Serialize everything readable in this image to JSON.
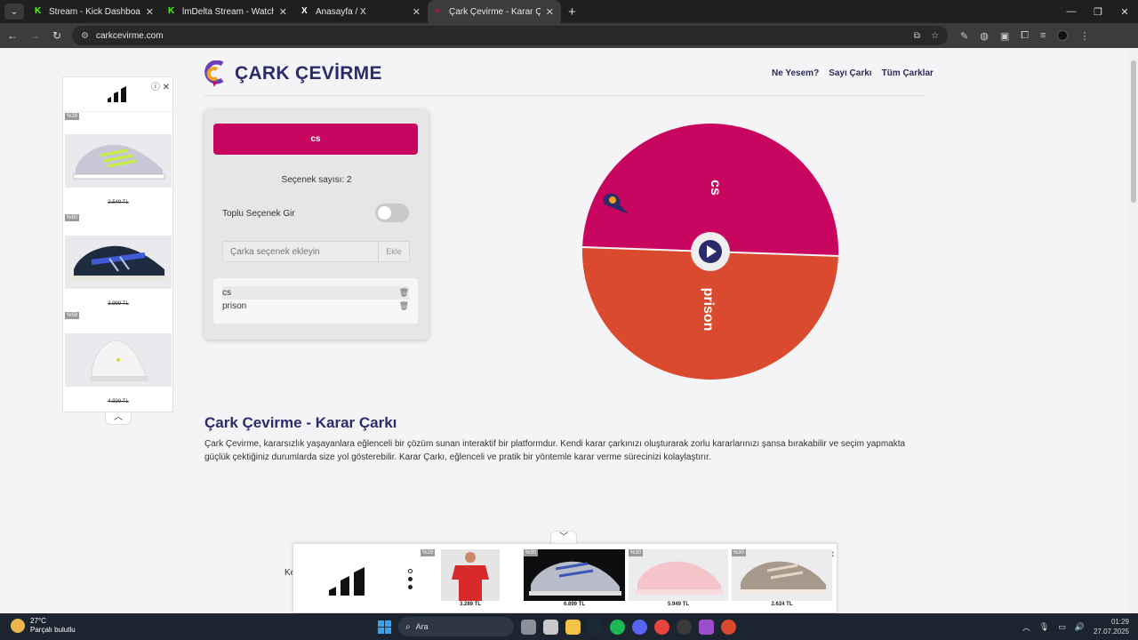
{
  "browser": {
    "tabs": [
      {
        "title": "Stream - Kick Dashboard",
        "icon": "kick-icon",
        "active": false
      },
      {
        "title": "lmDelta Stream - Watch Live on",
        "icon": "kick-icon",
        "active": false
      },
      {
        "title": "Anasayfa / X",
        "icon": "x-icon",
        "active": false
      },
      {
        "title": "Çark Çevirme - Karar Çarkı!",
        "icon": "carkcevirme-icon",
        "active": true
      }
    ],
    "url": "carkcevirme.com"
  },
  "header": {
    "brand": "ÇARK ÇEVİRME",
    "nav": [
      "Ne Yesem?",
      "Sayı Çarkı",
      "Tüm Çarklar"
    ]
  },
  "panel": {
    "spin_label": "cs",
    "count_text": "Seçenek sayısı: 2",
    "bulk_label": "Toplu Seçenek Gir",
    "bulk_enabled": false,
    "input_placeholder": "Çarka seçenek ekleyin",
    "add_label": "Ekle",
    "options": [
      "cs",
      "prison"
    ]
  },
  "wheel": {
    "segments": [
      {
        "label": "cs",
        "color": "#c8065f"
      },
      {
        "label": "prison",
        "color": "#d94a2e"
      }
    ]
  },
  "article": {
    "title": "Çark Çevirme - Karar Çarkı",
    "body": "Çark Çevirme, kararsızlık yaşayanlara eğlenceli bir çözüm sunan interaktif bir platformdur. Kendi karar çarkınızı oluşturarak zorlu kararlarınızı şansa bırakabilir ve seçim yapmakta güçlük çektiğiniz durumlarda size yol gösterebilir. Karar Çarkı, eğlenceli ve pratik bir yöntemle karar verme sürecinizi kolaylaştırır.",
    "fragment": "Ke"
  },
  "side_ad": {
    "products": [
      {
        "badge": "%29",
        "price": "2.549 TL"
      },
      {
        "badge": "%50",
        "price": "3.999 TL"
      },
      {
        "badge": "%59",
        "price": "4.929 TL"
      }
    ]
  },
  "bottom_ad": {
    "products": [
      {
        "badge": "%29",
        "price": "3.289 TL"
      },
      {
        "badge": "%30",
        "price": "6.899 TL"
      },
      {
        "badge": "%30",
        "price": "5.949 TL"
      },
      {
        "badge": "%30",
        "price": "2.624 TL"
      }
    ]
  },
  "taskbar": {
    "temperature": "27°C",
    "weather": "Parçalı bulutlu",
    "search_label": "Ara",
    "time": "01:29",
    "date": "27.07.2025"
  },
  "colors": {
    "brand": "#2b2b6b",
    "accent": "#c8065f",
    "secondary": "#d94a2e"
  }
}
